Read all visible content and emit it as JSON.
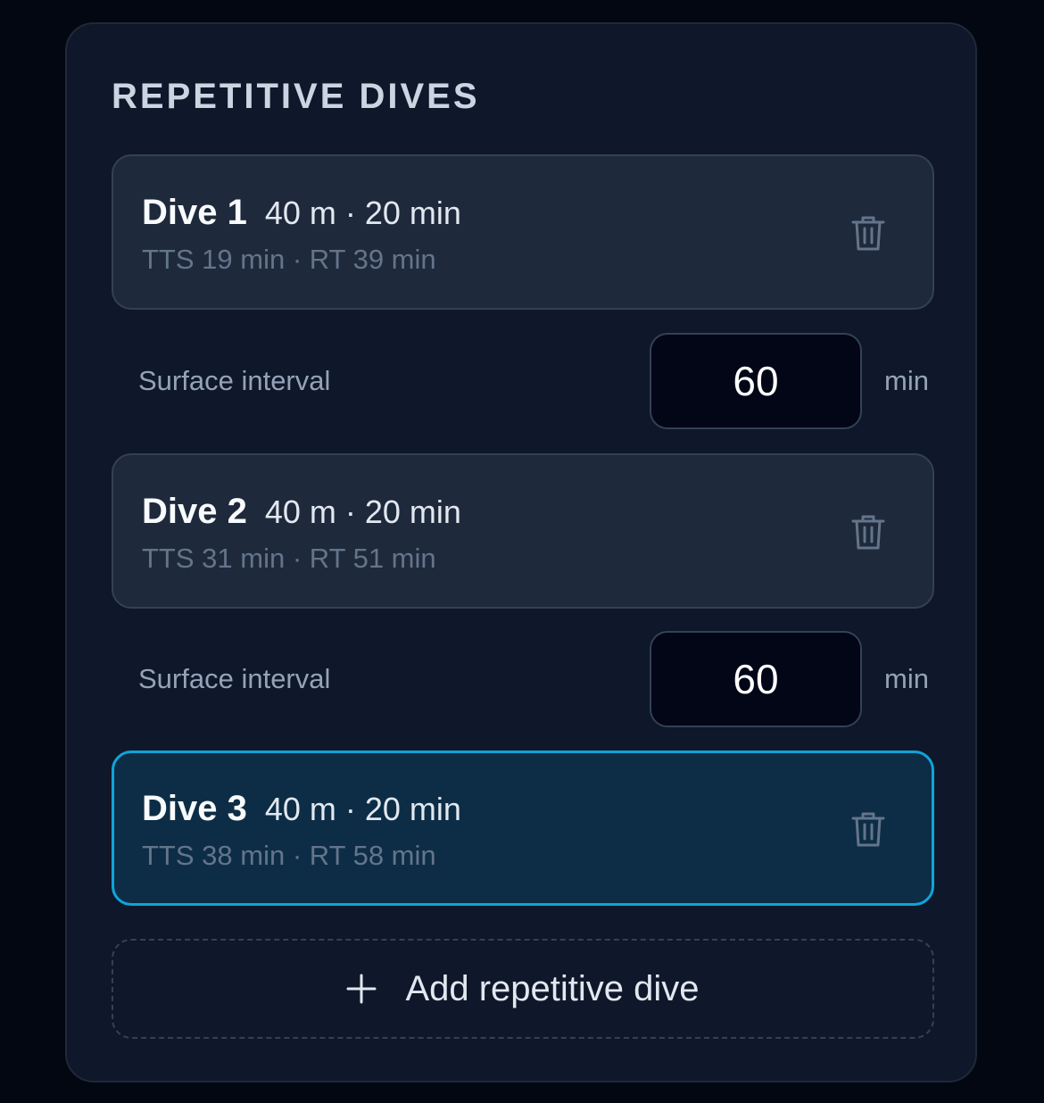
{
  "section": {
    "title": "REPETITIVE DIVES"
  },
  "dives": [
    {
      "name": "Dive 1",
      "spec": "40 m · 20 min",
      "stats": "TTS 19 min · RT 39 min",
      "selected": false
    },
    {
      "name": "Dive 2",
      "spec": "40 m · 20 min",
      "stats": "TTS 31 min · RT 51 min",
      "selected": false
    },
    {
      "name": "Dive 3",
      "spec": "40 m · 20 min",
      "stats": "TTS 38 min · RT 58 min",
      "selected": true
    }
  ],
  "intervals": [
    {
      "label": "Surface interval",
      "value": "60",
      "unit": "min"
    },
    {
      "label": "Surface interval",
      "value": "60",
      "unit": "min"
    }
  ],
  "add_button": {
    "label": "Add repetitive dive",
    "icon": "plus-icon"
  },
  "icons": {
    "delete": "trash-icon"
  },
  "colors": {
    "accent": "#0ea5d9",
    "selected_background": "#0c2d45",
    "card_background": "#1e293b",
    "panel_background": "#0f172a",
    "page_background": "#030712"
  }
}
